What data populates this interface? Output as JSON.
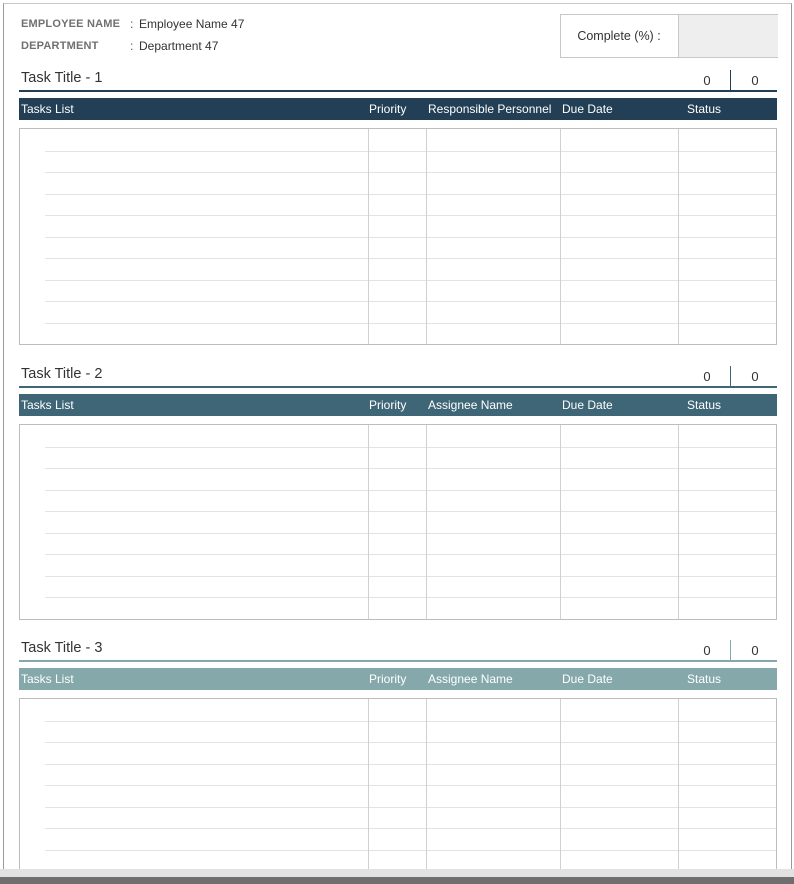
{
  "header": {
    "employee_label": "EMPLOYEE NAME",
    "employee_value": "Employee Name 47",
    "department_label": "DEPARTMENT",
    "department_value": "Department 47",
    "colon": ":"
  },
  "complete": {
    "label": "Complete (%) :",
    "value": ""
  },
  "sections": [
    {
      "title": "Task Title - 1",
      "count_done": "0",
      "count_total": "0",
      "columns": [
        "Tasks List",
        "Priority",
        "Responsible Personnel",
        "Due Date",
        "Status"
      ],
      "header_color": "#223f56",
      "rule_color": "#223f56"
    },
    {
      "title": "Task Title - 2",
      "count_done": "0",
      "count_total": "0",
      "columns": [
        "Tasks List",
        "Priority",
        "Assignee Name",
        "Due Date",
        "Status"
      ],
      "header_color": "#3f6677",
      "rule_color": "#3f6677"
    },
    {
      "title": "Task Title - 3",
      "count_done": "0",
      "count_total": "0",
      "columns": [
        "Tasks List",
        "Priority",
        "Assignee Name",
        "Due Date",
        "Status"
      ],
      "header_color": "#85a8aa",
      "rule_color": "#85a8aa"
    }
  ]
}
